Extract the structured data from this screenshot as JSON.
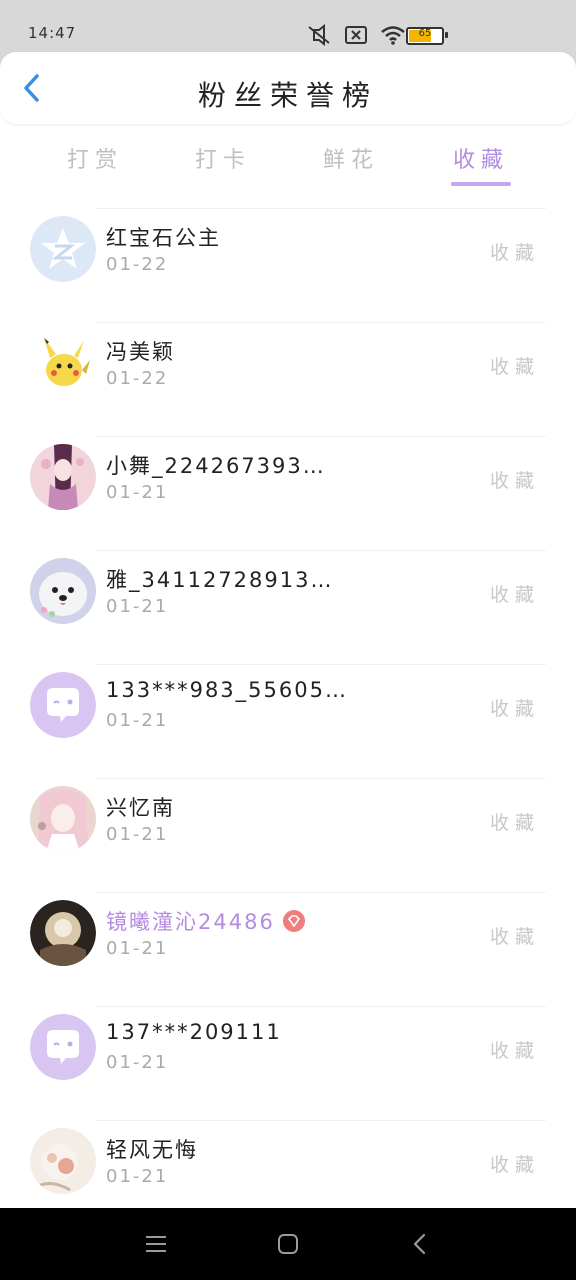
{
  "status_bar": {
    "time": "14:47",
    "battery": "65",
    "icons": [
      "mute-icon",
      "no-sim-icon",
      "wifi-icon",
      "battery-icon"
    ]
  },
  "header": {
    "title": "粉丝荣誉榜",
    "back_icon": "chevron-left-icon"
  },
  "tabs": [
    {
      "label": "打赏",
      "active": false
    },
    {
      "label": "打卡",
      "active": false
    },
    {
      "label": "鲜花",
      "active": false
    },
    {
      "label": "收藏",
      "active": true
    }
  ],
  "accent_color": "#b28ee0",
  "list": [
    {
      "name": "红宝石公主",
      "date": "01-22",
      "action": "收藏",
      "avatar": "qq-logo-avatar"
    },
    {
      "name": "冯美颖",
      "date": "01-22",
      "action": "收藏",
      "avatar": "pikachu-avatar"
    },
    {
      "name": "小舞_224267393…",
      "date": "01-21",
      "action": "收藏",
      "avatar": "anime-girl-avatar"
    },
    {
      "name": "雅_34112728913…",
      "date": "01-21",
      "action": "收藏",
      "avatar": "white-dog-avatar"
    },
    {
      "name": "133***983_55605…",
      "date": "01-21",
      "action": "收藏",
      "avatar": "default-chat-avatar"
    },
    {
      "name": "兴忆南",
      "date": "01-21",
      "action": "收藏",
      "avatar": "pink-girl-avatar"
    },
    {
      "name": "镜曦潼沁24486",
      "date": "01-21",
      "action": "收藏",
      "avatar": "dark-photo-avatar",
      "vip": true
    },
    {
      "name": "137***209111",
      "date": "01-21",
      "action": "收藏",
      "avatar": "default-chat-avatar"
    },
    {
      "name": "轻风无悔",
      "date": "01-21",
      "action": "收藏",
      "avatar": "flower-photo-avatar"
    }
  ],
  "nav_bar": [
    "menu-icon",
    "home-icon",
    "back-icon"
  ]
}
